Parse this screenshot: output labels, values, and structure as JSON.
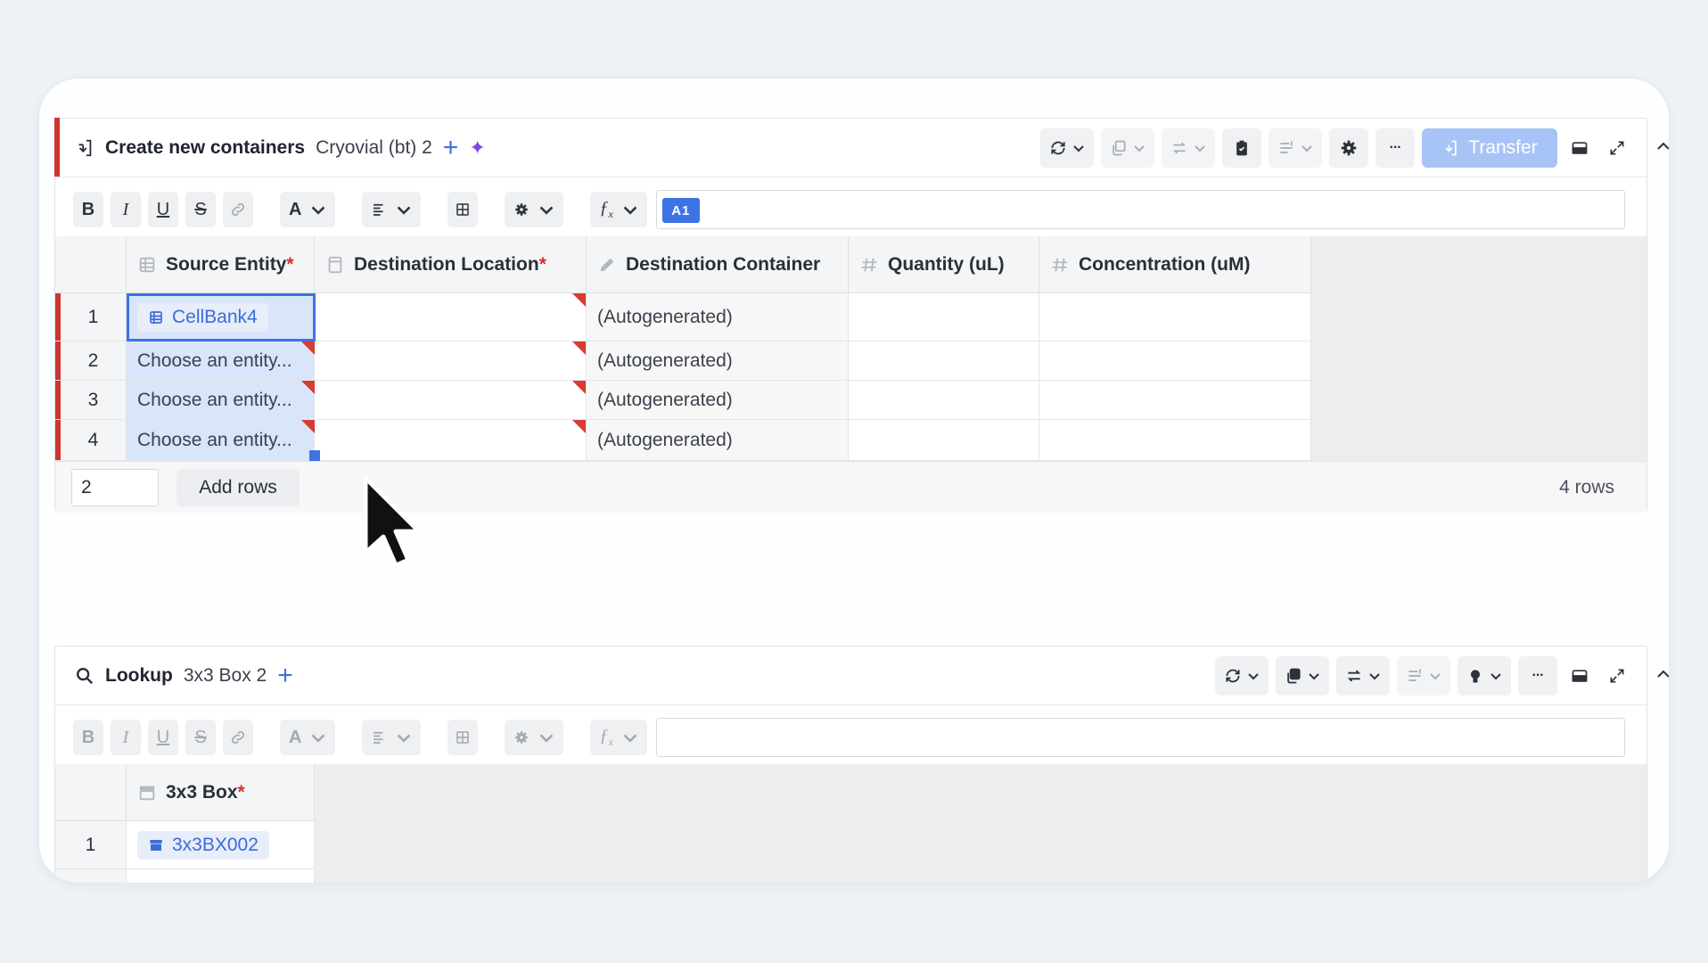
{
  "panel1": {
    "title": "Create new containers",
    "subtitle": "Cryovial (bt) 2",
    "add_symbol": "+",
    "ai_symbol": "✦",
    "transfer_label": "Transfer",
    "cell_ref": "A1",
    "columns": [
      {
        "label": "Source Entity",
        "required": "*",
        "icon": "table-icon"
      },
      {
        "label": "Destination Location",
        "required": "*",
        "icon": "box-icon"
      },
      {
        "label": "Destination Container",
        "required": "",
        "icon": "pencil-icon"
      },
      {
        "label": "Quantity (uL)",
        "required": "",
        "icon": "hash-icon"
      },
      {
        "label": "Concentration (uM)",
        "required": "",
        "icon": "hash-icon"
      }
    ],
    "rows": [
      {
        "num": "1",
        "source": "CellBank4",
        "container": "(Autogenerated)"
      },
      {
        "num": "2",
        "source": "Choose an entity...",
        "container": "(Autogenerated)"
      },
      {
        "num": "3",
        "source": "Choose an entity...",
        "container": "(Autogenerated)"
      },
      {
        "num": "4",
        "source": "Choose an entity...",
        "container": "(Autogenerated)"
      }
    ],
    "add_count": "2",
    "add_rows_label": "Add rows",
    "row_count": "4 rows"
  },
  "panel2": {
    "title": "Lookup",
    "subtitle": "3x3 Box 2",
    "add_symbol": "+",
    "columns": [
      {
        "label": "3x3 Box",
        "required": "*",
        "icon": "box-icon"
      }
    ],
    "rows": [
      {
        "num": "1",
        "value": "3x3BX002"
      }
    ]
  },
  "toolbar": {
    "bold": "B",
    "italic": "I",
    "underline": "U",
    "strike": "S",
    "font": "A",
    "formula": "ƒ",
    "formula_sub": "x",
    "more": "···"
  },
  "colors": {
    "accent": "#3d73e4",
    "error": "#d0342f",
    "ai": "#7b48e3",
    "transfer_disabled": "#a8c3f5"
  }
}
